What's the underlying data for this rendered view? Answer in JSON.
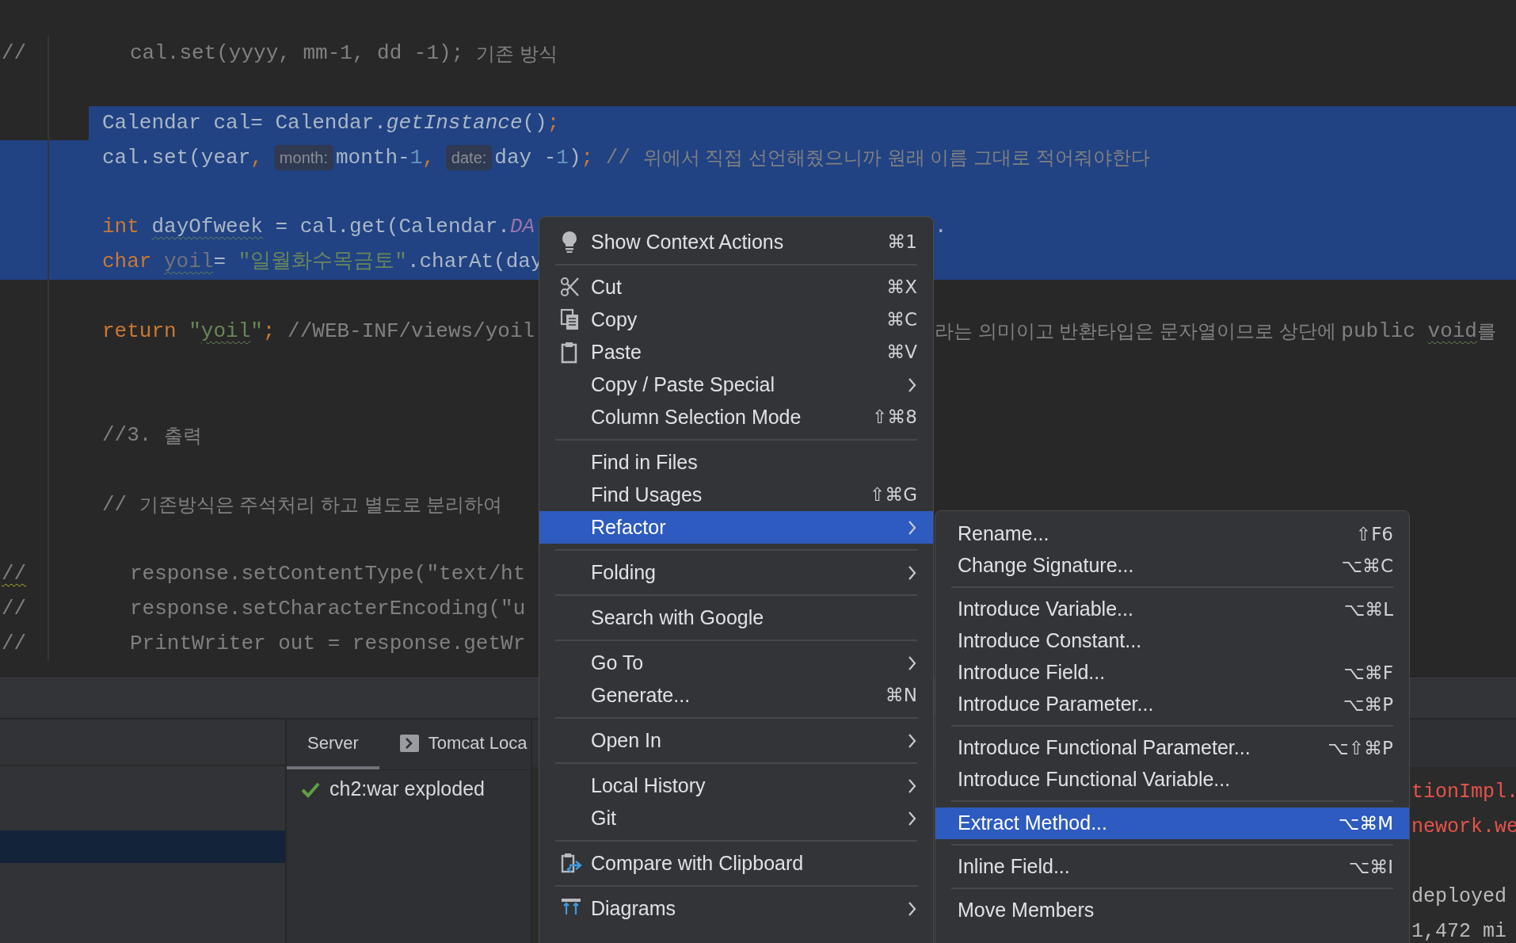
{
  "code_lines": [
    {
      "kind": "commented",
      "selected": false,
      "gutter": "//",
      "gutter_warning": false,
      "segments": [
        {
          "text": "cal.set(yyyy, mm-1, dd -1); ",
          "kind": "comment"
        },
        {
          "text": "기존 방식",
          "kind": "hangul_comment"
        }
      ]
    },
    {
      "kind": "blank",
      "selected": false
    },
    {
      "kind": "code",
      "selected": true,
      "segments": [
        {
          "text": "Calendar cal= Calendar.",
          "kind": "plain"
        },
        {
          "text": "getInstance",
          "kind": "method"
        },
        {
          "text": "()",
          "kind": "plain"
        },
        {
          "text": ";",
          "kind": "punct"
        }
      ]
    },
    {
      "kind": "code",
      "selected": true,
      "segments": [
        {
          "text": "cal.set(year",
          "kind": "plain"
        },
        {
          "text": ",",
          "kind": "punct"
        },
        {
          "text": "month:",
          "kind": "hint"
        },
        {
          "text": "month-",
          "kind": "plain"
        },
        {
          "text": "1",
          "kind": "number"
        },
        {
          "text": ",",
          "kind": "punct"
        },
        {
          "text": "date:",
          "kind": "hint"
        },
        {
          "text": "day -",
          "kind": "plain"
        },
        {
          "text": "1",
          "kind": "number"
        },
        {
          "text": ")",
          "kind": "plain"
        },
        {
          "text": ";",
          "kind": "punct"
        },
        {
          "text": " // ",
          "kind": "comment"
        },
        {
          "text": "위에서 직접 선언해줬으니까 원래 이름 그대로 적어줘야한다",
          "kind": "hangul_comment"
        }
      ]
    },
    {
      "kind": "blank",
      "selected": true
    },
    {
      "kind": "code",
      "selected": true,
      "segments": [
        {
          "text": "int ",
          "kind": "keyword"
        },
        {
          "text": "dayOfweek",
          "kind": "typo"
        },
        {
          "text": " = cal.get(Calendar.",
          "kind": "plain"
        },
        {
          "text": "DA",
          "kind": "constant"
        }
      ],
      "right_segments": [
        {
          "text": ".",
          "kind": "plain"
        }
      ]
    },
    {
      "kind": "code",
      "selected": true,
      "segments": [
        {
          "text": "char ",
          "kind": "keyword"
        },
        {
          "text": "yoil",
          "kind": "unused"
        },
        {
          "text": "= ",
          "kind": "plain"
        },
        {
          "text": "\"일월화수목금토\"",
          "kind": "string"
        },
        {
          "text": ".charAt(day",
          "kind": "plain"
        }
      ]
    },
    {
      "kind": "blank",
      "selected": false
    },
    {
      "kind": "code",
      "selected": false,
      "segments": [
        {
          "text": "return ",
          "kind": "keyword"
        },
        {
          "text": "\"",
          "kind": "string"
        },
        {
          "text": "yoil",
          "kind": "string_typo"
        },
        {
          "text": "\"",
          "kind": "string"
        },
        {
          "text": ";",
          "kind": "punct"
        },
        {
          "text": " //WEB-INF/views/yoil",
          "kind": "comment"
        }
      ],
      "right_segments": [
        {
          "text": "라는 의미이고 반환타입은 문자열이므로 상단에 ",
          "kind": "hangul_comment"
        },
        {
          "text": "public ",
          "kind": "comment"
        },
        {
          "text": "void",
          "kind": "comment_typo"
        },
        {
          "text": "를",
          "kind": "hangul_comment"
        }
      ]
    },
    {
      "kind": "blank",
      "selected": false
    },
    {
      "kind": "blank",
      "selected": false
    },
    {
      "kind": "code",
      "selected": false,
      "segments": [
        {
          "text": "//3. ",
          "kind": "comment"
        },
        {
          "text": "출력",
          "kind": "hangul_comment"
        }
      ]
    },
    {
      "kind": "blank",
      "selected": false
    },
    {
      "kind": "code",
      "selected": false,
      "segments": [
        {
          "text": "// ",
          "kind": "comment"
        },
        {
          "text": "기존방식은 주석처리 하고 별도로 분리하여",
          "kind": "hangul_comment"
        }
      ]
    },
    {
      "kind": "blank",
      "selected": false
    },
    {
      "kind": "commented",
      "selected": false,
      "gutter": "//",
      "gutter_warning": true,
      "segments": [
        {
          "text": "response.setContentType(\"text/ht",
          "kind": "comment"
        }
      ]
    },
    {
      "kind": "commented",
      "selected": false,
      "gutter": "//",
      "gutter_warning": false,
      "segments": [
        {
          "text": "response.setCharacterEncoding(\"u",
          "kind": "comment"
        }
      ]
    },
    {
      "kind": "commented",
      "selected": false,
      "gutter": "//",
      "gutter_warning": false,
      "segments": [
        {
          "text": "PrintWriter out = response.getWr",
          "kind": "comment"
        }
      ]
    }
  ],
  "tree_rows": [
    {
      "selected": false
    },
    {
      "selected": false
    },
    {
      "selected": true
    }
  ],
  "server_tabs": [
    {
      "label": "Server",
      "selected": true
    },
    {
      "label": "Tomcat Loca",
      "selected": false
    }
  ],
  "deployments": [
    {
      "label": "ch2:war exploded",
      "deployed": true
    }
  ],
  "console_lines": [
    {
      "text": "tionImpl.",
      "kind": "error"
    },
    {
      "text": "nework.we",
      "kind": "error"
    },
    {
      "kind": "blank"
    },
    {
      "text": "deployed",
      "kind": "info"
    },
    {
      "text": "1,472 mi",
      "kind": "info"
    }
  ],
  "context_menu": {
    "groups": [
      [
        {
          "label": "Show Context Actions",
          "shortcut": "⌘1",
          "submenu": false,
          "selected": false
        }
      ],
      [
        {
          "label": "Cut",
          "shortcut": "⌘X",
          "submenu": false,
          "selected": false
        },
        {
          "label": "Copy",
          "shortcut": "⌘C",
          "submenu": false,
          "selected": false
        },
        {
          "label": "Paste",
          "shortcut": "⌘V",
          "submenu": false,
          "selected": false
        },
        {
          "label": "Copy / Paste Special",
          "submenu": true,
          "selected": false
        },
        {
          "label": "Column Selection Mode",
          "shortcut": "⇧⌘8",
          "submenu": false,
          "selected": false
        }
      ],
      [
        {
          "label": "Find in Files",
          "submenu": false,
          "selected": false
        },
        {
          "label": "Find Usages",
          "shortcut": "⇧⌘G",
          "submenu": false,
          "selected": false
        },
        {
          "label": "Refactor",
          "submenu": true,
          "selected": true
        }
      ],
      [
        {
          "label": "Folding",
          "submenu": true,
          "selected": false
        }
      ],
      [
        {
          "label": "Search with Google",
          "submenu": false,
          "selected": false
        }
      ],
      [
        {
          "label": "Go To",
          "submenu": true,
          "selected": false
        },
        {
          "label": "Generate...",
          "shortcut": "⌘N",
          "submenu": false,
          "selected": false
        }
      ],
      [
        {
          "label": "Open In",
          "submenu": true,
          "selected": false
        }
      ],
      [
        {
          "label": "Local History",
          "submenu": true,
          "selected": false
        },
        {
          "label": "Git",
          "submenu": true,
          "selected": false
        }
      ],
      [
        {
          "label": "Compare with Clipboard",
          "submenu": false,
          "selected": false
        }
      ],
      [
        {
          "label": "Diagrams",
          "submenu": true,
          "selected": false
        }
      ]
    ]
  },
  "refactor_submenu": {
    "groups": [
      [
        {
          "label": "Rename...",
          "shortcut": "⇧F6",
          "selected": false
        },
        {
          "label": "Change Signature...",
          "shortcut": "⌥⌘C",
          "selected": false
        }
      ],
      [
        {
          "label": "Introduce Variable...",
          "shortcut": "⌥⌘L",
          "selected": false
        },
        {
          "label": "Introduce Constant...",
          "selected": false
        },
        {
          "label": "Introduce Field...",
          "shortcut": "⌥⌘F",
          "selected": false
        },
        {
          "label": "Introduce Parameter...",
          "shortcut": "⌥⌘P",
          "selected": false
        }
      ],
      [
        {
          "label": "Introduce Functional Parameter...",
          "shortcut": "⌥⇧⌘P",
          "selected": false
        },
        {
          "label": "Introduce Functional Variable...",
          "selected": false
        }
      ],
      [
        {
          "label": "Extract Method...",
          "shortcut": "⌥⌘M",
          "selected": true
        }
      ],
      [
        {
          "label": "Inline Field...",
          "shortcut": "⌥⌘I",
          "selected": false
        }
      ],
      [
        {
          "label": "Move Members",
          "selected": false
        }
      ]
    ]
  }
}
